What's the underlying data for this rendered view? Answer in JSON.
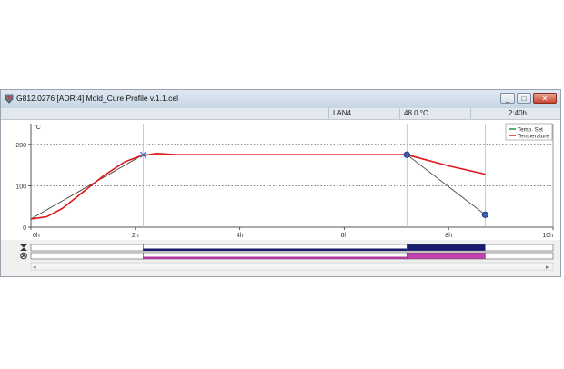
{
  "window": {
    "title": "G812.0276 [ADR:4] Mold_Cure Profile v.1.1.cel",
    "controls": {
      "minimize": "_",
      "maximize": "□",
      "close": "✕"
    }
  },
  "status": {
    "connection": "LAN4",
    "temperature": "48.0 °C",
    "elapsed": "2:40h"
  },
  "chart_data": {
    "type": "line",
    "ylabel": "°C",
    "xlabel": "",
    "xlim": [
      0,
      10
    ],
    "ylim": [
      0,
      250
    ],
    "x_ticks": [
      "0h",
      "2h",
      "4h",
      "6h",
      "8h",
      "10h"
    ],
    "y_ticks": [
      "0",
      "100",
      "200"
    ],
    "grid": "horizontal dotted",
    "legend": "top-right",
    "series": [
      {
        "name": "Temp. Set",
        "color": "#1a8a3a",
        "x": [
          0,
          2.15,
          7.2,
          8.7
        ],
        "y": [
          20,
          175,
          175,
          30
        ]
      },
      {
        "name": "Temperature",
        "color": "#e01818",
        "x": [
          0,
          0.3,
          0.6,
          1.0,
          1.4,
          1.8,
          2.1,
          2.4,
          2.8,
          3.5,
          5,
          7.2,
          7.5,
          8,
          8.7
        ],
        "y": [
          20,
          25,
          45,
          85,
          125,
          158,
          172,
          178,
          175,
          175,
          175,
          175,
          165,
          148,
          128
        ]
      }
    ],
    "markers": [
      {
        "x": 2.15,
        "y": 175,
        "shape": "x",
        "color": "#4a6fc8"
      },
      {
        "x": 7.2,
        "y": 175,
        "shape": "circle",
        "color": "#3a5fb8"
      },
      {
        "x": 8.7,
        "y": 30,
        "shape": "circle",
        "color": "#3a5fb8"
      }
    ]
  },
  "tracks": {
    "rows": [
      {
        "icon": "hourglass-icon",
        "segments": [
          {
            "start": 0,
            "end": 2.15,
            "color": "#ffffff"
          },
          {
            "start": 2.15,
            "end": 7.2,
            "color": "#ffffff",
            "underline": "#1a1a70"
          },
          {
            "start": 7.2,
            "end": 8.7,
            "color": "#1a1a70"
          },
          {
            "start": 8.7,
            "end": 10,
            "color": "#ffffff"
          }
        ]
      },
      {
        "icon": "fan-icon",
        "segments": [
          {
            "start": 0,
            "end": 2.15,
            "color": "#ffffff"
          },
          {
            "start": 2.15,
            "end": 7.2,
            "color": "#ffffff",
            "underline": "#b03aa0"
          },
          {
            "start": 7.2,
            "end": 8.7,
            "color": "#c040b0"
          },
          {
            "start": 8.7,
            "end": 10,
            "color": "#ffffff"
          }
        ]
      }
    ],
    "scroll_left": "◂",
    "scroll_right": "▸"
  }
}
